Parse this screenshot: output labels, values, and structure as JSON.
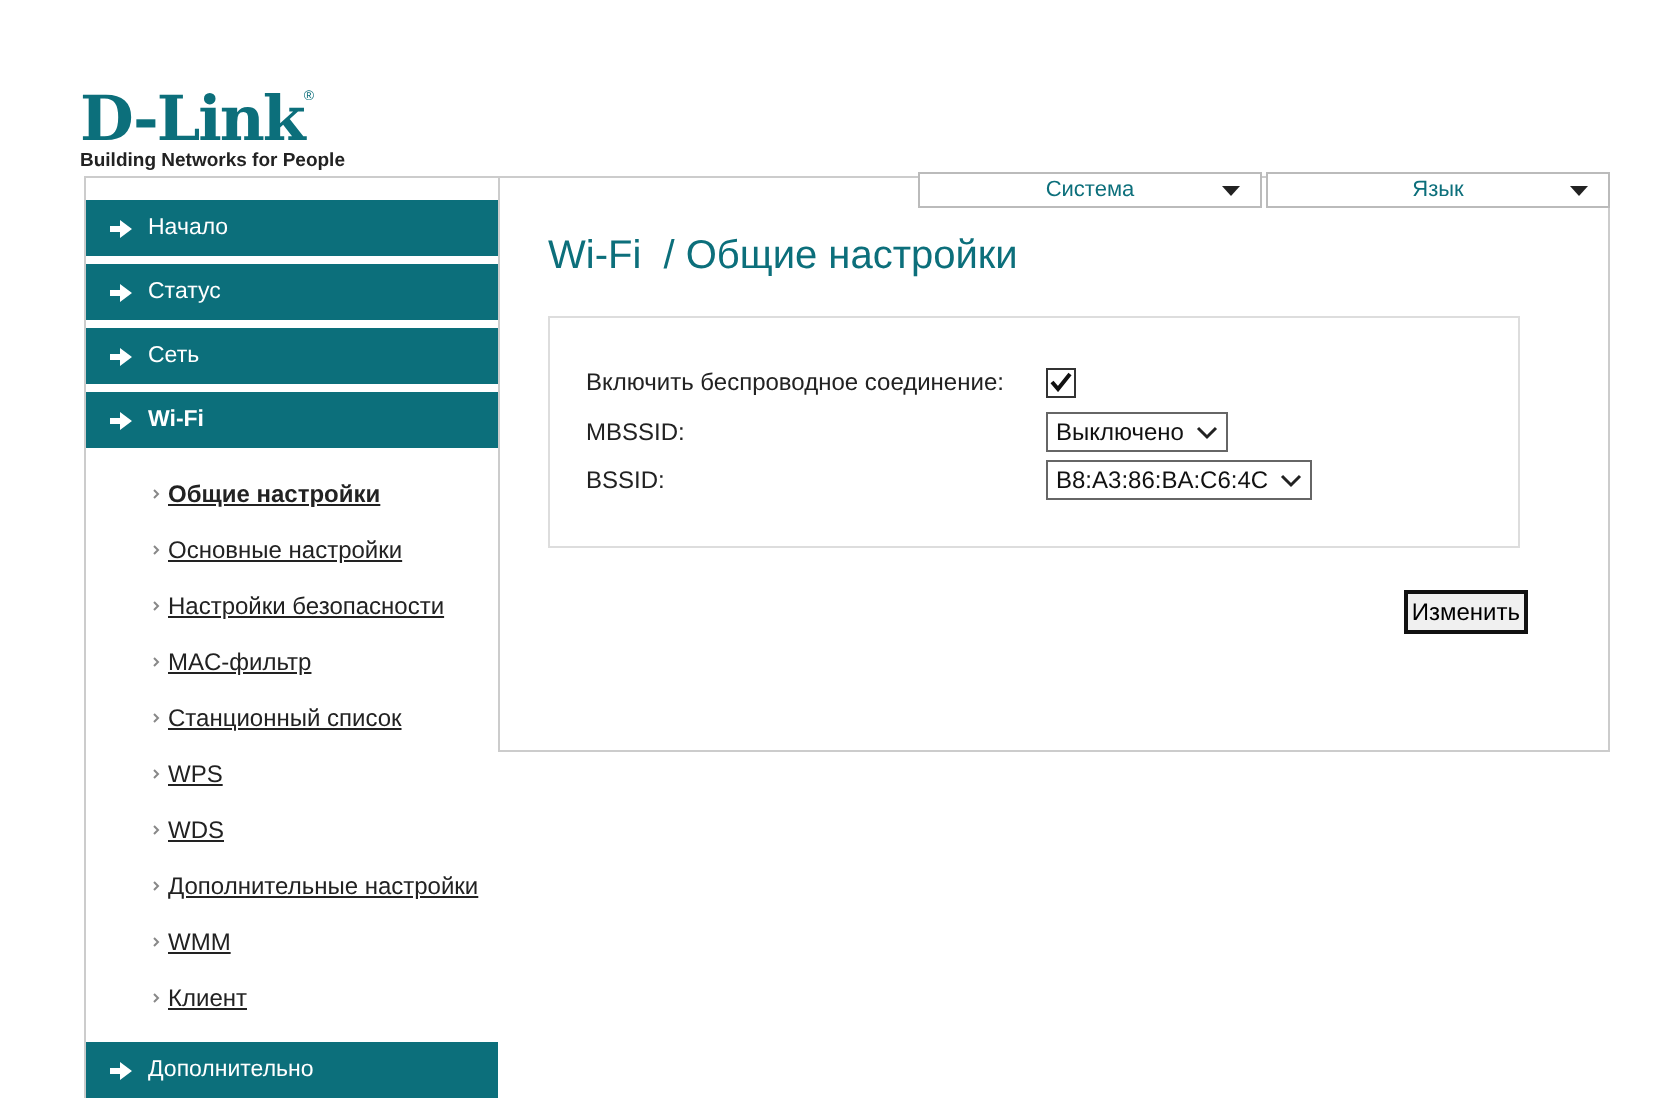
{
  "logo": {
    "brand": "D-Link",
    "registered": "®",
    "tagline": "Building Networks for People"
  },
  "top_menu": [
    {
      "label": "Система"
    },
    {
      "label": "Язык"
    }
  ],
  "sidebar": {
    "items": [
      {
        "label": "Начало",
        "expanded": false
      },
      {
        "label": "Статус",
        "expanded": false
      },
      {
        "label": "Сеть",
        "expanded": false
      },
      {
        "label": "Wi-Fi",
        "expanded": true,
        "children": [
          {
            "label": "Общие настройки",
            "selected": true
          },
          {
            "label": "Основные настройки",
            "selected": false
          },
          {
            "label": "Настройки безопасности",
            "selected": false
          },
          {
            "label": "MAC-фильтр",
            "selected": false
          },
          {
            "label": "Станционный список",
            "selected": false
          },
          {
            "label": "WPS",
            "selected": false
          },
          {
            "label": "WDS",
            "selected": false
          },
          {
            "label": "Дополнительные настройки",
            "selected": false
          },
          {
            "label": "WMM",
            "selected": false
          },
          {
            "label": "Клиент",
            "selected": false
          }
        ]
      },
      {
        "label": "Дополнительно",
        "expanded": false
      }
    ]
  },
  "page_title": "Wi-Fi  / Общие настройки",
  "form": {
    "fields": [
      {
        "kind": "checkbox",
        "label": "Включить беспроводное соединение:",
        "checked": true
      },
      {
        "kind": "select",
        "label": "MBSSID:",
        "value": "Выключено"
      },
      {
        "kind": "select",
        "label": "BSSID:",
        "value": "B8:A3:86:BA:C6:4C"
      }
    ]
  },
  "apply_button": "Изменить"
}
